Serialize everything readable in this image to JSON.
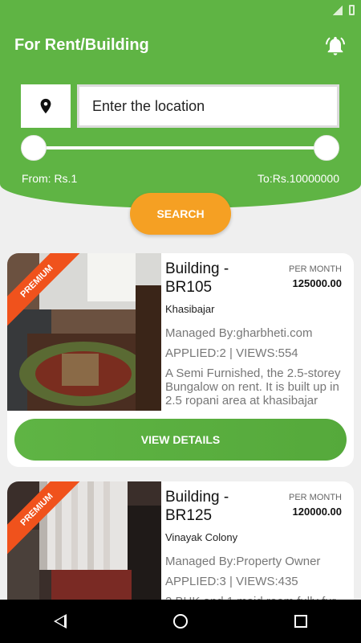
{
  "header": {
    "title": "For Rent/Building",
    "location_placeholder": "Enter the location",
    "price_from": "From: Rs.1",
    "price_to": "To:Rs.10000000",
    "search_label": "SEARCH"
  },
  "listings": [
    {
      "badge": "PREMIUM",
      "title": "Building - BR105",
      "period": "PER MONTH",
      "price": "125000.00",
      "locality": "Khasibajar",
      "managed_by": "Managed By:gharbheti.com",
      "stats": "APPLIED:2 | VIEWS:554",
      "description": "A Semi Furnished, the 2.5-storey Bungalow on rent. It is built up in 2.5 ropani area at khasibajar",
      "action": "VIEW DETAILS"
    },
    {
      "badge": "PREMIUM",
      "title": "Building - BR125",
      "period": "PER MONTH",
      "price": "120000.00",
      "locality": "Vinayak Colony",
      "managed_by": "Managed By:Property Owner",
      "stats": "APPLIED:3 | VIEWS:435",
      "description": "3 BHK and 1 maid room fully fur"
    }
  ],
  "colors": {
    "primary": "#5fb444",
    "accent": "#f5a023",
    "ribbon": "#f0521c"
  },
  "icons": [
    "bell-icon",
    "location-pin-icon",
    "back-icon",
    "home-icon",
    "recents-icon"
  ]
}
